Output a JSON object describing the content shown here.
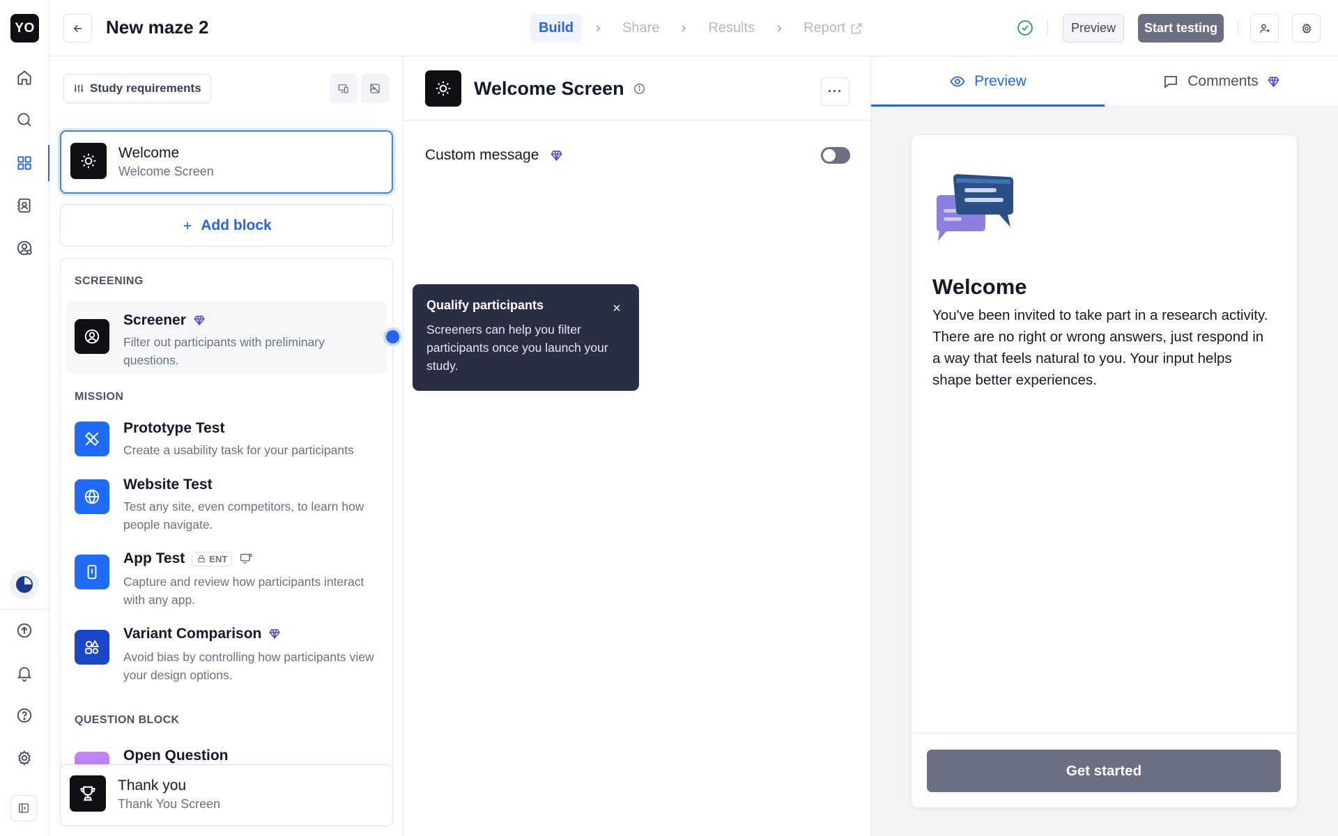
{
  "app": {
    "logo_text": "YO",
    "rail_icons": [
      "home-icon",
      "search-icon",
      "grid-icon",
      "contacts-icon",
      "participants-icon",
      "usage-icon",
      "updates-icon",
      "bell-icon",
      "help-icon",
      "settings-icon",
      "collapse-icon"
    ]
  },
  "header": {
    "title": "New maze 2",
    "steps": [
      {
        "label": "Build",
        "active": true
      },
      {
        "label": "Share",
        "active": false
      },
      {
        "label": "Results",
        "active": false
      },
      {
        "label": "Report",
        "active": false
      }
    ],
    "preview_label": "Preview",
    "start_label": "Start testing"
  },
  "blocks_panel": {
    "requirements_label": "Study requirements",
    "welcome": {
      "title": "Welcome",
      "subtitle": "Welcome Screen"
    },
    "add_block_label": "Add block",
    "sections": [
      {
        "heading": "SCREENING"
      },
      {
        "heading": "MISSION"
      },
      {
        "heading": "QUESTION BLOCK"
      }
    ],
    "items": [
      {
        "title": "Screener",
        "desc": "Filter out participants with preliminary questions.",
        "premium": true
      },
      {
        "title": "Prototype Test",
        "desc": "Create a usability task for your participants"
      },
      {
        "title": "Website Test",
        "desc": "Test any site, even competitors, to learn how people navigate."
      },
      {
        "title": "App Test",
        "desc": "Capture and review how participants interact with any app.",
        "badge": "ENT"
      },
      {
        "title": "Variant Comparison",
        "desc": "Avoid bias by controlling how participants view your design options.",
        "premium": true
      },
      {
        "title": "Open Question"
      }
    ],
    "thanks": {
      "title": "Thank you",
      "subtitle": "Thank You Screen"
    }
  },
  "editor": {
    "title": "Welcome Screen",
    "custom_message_label": "Custom message",
    "custom_message_enabled": false
  },
  "tooltip": {
    "title": "Qualify participants",
    "body": "Screeners can help you filter participants once you launch your study."
  },
  "preview": {
    "tabs": [
      {
        "label": "Preview",
        "active": true
      },
      {
        "label": "Comments",
        "active": false
      }
    ],
    "screen_title": "Welcome",
    "screen_body": "You've been invited to take part in a research activity. There are no right or wrong answers, just respond in a way that feels natural to you. Your input helps shape better experiences.",
    "cta_label": "Get started"
  },
  "colors": {
    "accent": "#2563eb",
    "dark": "#101014",
    "button_gray": "#6b6f82",
    "premium": "#4f46e5",
    "prototype_icon": "#1f6bff",
    "variant_icon": "#1a46c9",
    "open_question_icon": "#c084fc"
  }
}
